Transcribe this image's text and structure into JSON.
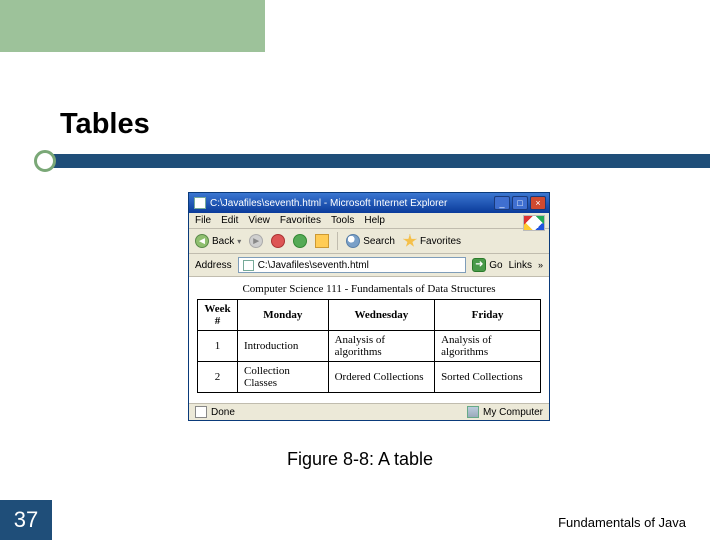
{
  "slide": {
    "title": "Tables",
    "caption": "Figure 8-8: A table",
    "page_number": "37",
    "footer": "Fundamentals of Java"
  },
  "browser": {
    "title": "C:\\Javafiles\\seventh.html - Microsoft Internet Explorer",
    "menu": {
      "file": "File",
      "edit": "Edit",
      "view": "View",
      "favorites": "Favorites",
      "tools": "Tools",
      "help": "Help"
    },
    "toolbar": {
      "back": "Back",
      "search": "Search",
      "favorites": "Favorites"
    },
    "address_label": "Address",
    "address_value": "C:\\Javafiles\\seventh.html",
    "go": "Go",
    "links": "Links",
    "status_left": "Done",
    "status_right": "My Computer"
  },
  "page": {
    "heading": "Computer Science 111 - Fundamentals of Data Structures",
    "headers": {
      "week": "Week #",
      "mon": "Monday",
      "wed": "Wednesday",
      "fri": "Friday"
    },
    "rows": [
      {
        "week": "1",
        "mon": "Introduction",
        "wed": "Analysis of algorithms",
        "fri": "Analysis of algorithms"
      },
      {
        "week": "2",
        "mon": "Collection Classes",
        "wed": "Ordered Collections",
        "fri": "Sorted Collections"
      }
    ]
  }
}
